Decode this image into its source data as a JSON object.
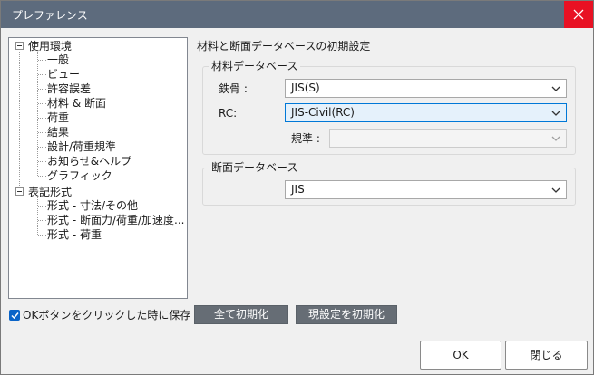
{
  "window": {
    "title": "プレファレンス"
  },
  "tree": {
    "groups": [
      {
        "label": "使用環境",
        "items": [
          "一般",
          "ビュー",
          "許容誤差",
          "材料 & 断面",
          "荷重",
          "結果",
          "設計/荷重規準",
          "お知らせ&ヘルプ",
          "グラフィック"
        ]
      },
      {
        "label": "表記形式",
        "items": [
          "形式 - 寸法/その他",
          "形式 - 断面力/荷重/加速度...",
          "形式 - 荷重"
        ]
      }
    ]
  },
  "main": {
    "title": "材料と断面データベースの初期設定",
    "material_group": {
      "title": "材料データベース",
      "steel_label": "鉄骨 :",
      "steel_value": "JIS(S)",
      "rc_label": "RC:",
      "rc_value": "JIS-Civil(RC)",
      "code_label": "規準 :",
      "code_value": ""
    },
    "section_group": {
      "title": "断面データベース",
      "value": "JIS"
    }
  },
  "options": {
    "save_on_ok_label": "OKボタンをクリックした時に保存",
    "save_on_ok_checked": true
  },
  "buttons": {
    "reset_all": "全て初期化",
    "reset_current": "現設定を初期化",
    "ok": "OK",
    "close": "閉じる"
  },
  "colors": {
    "titlebar": "#5d6b7d",
    "close": "#e81123",
    "accent": "#0078d7",
    "gray_button": "#666d75"
  }
}
